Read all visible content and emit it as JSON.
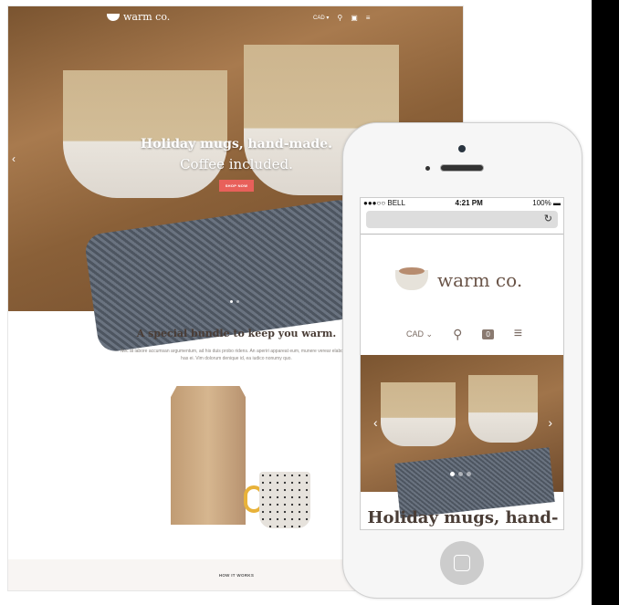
{
  "desktop": {
    "brand": "warm co.",
    "nav": {
      "currency": "CAD",
      "search_icon": "search-icon",
      "cart_icon": "bag-icon",
      "menu_icon": "hamburger-icon"
    },
    "hero": {
      "title": "Holiday mugs, hand-made.",
      "subtitle": "Coffee included.",
      "cta": "SHOP NOW",
      "button_color": "#e8605a"
    },
    "section": {
      "title": "A special bundle to keep you warm.",
      "body": "Nec at labore accumsan argumentum, ad his duis probo ridens. An aperiri appareat eum, munere verear elaboraret has ei. Vim dolorum denique id, ea iudico nonumy quo."
    },
    "footer_link": "HOW IT WORKS"
  },
  "phone": {
    "status": {
      "carrier": "●●●○○ BELL",
      "time": "4:21 PM",
      "battery": "100%"
    },
    "brand": "warm co.",
    "nav": {
      "currency": "CAD",
      "cart_count": "0"
    },
    "hero_title": "Holiday mugs, hand-"
  }
}
